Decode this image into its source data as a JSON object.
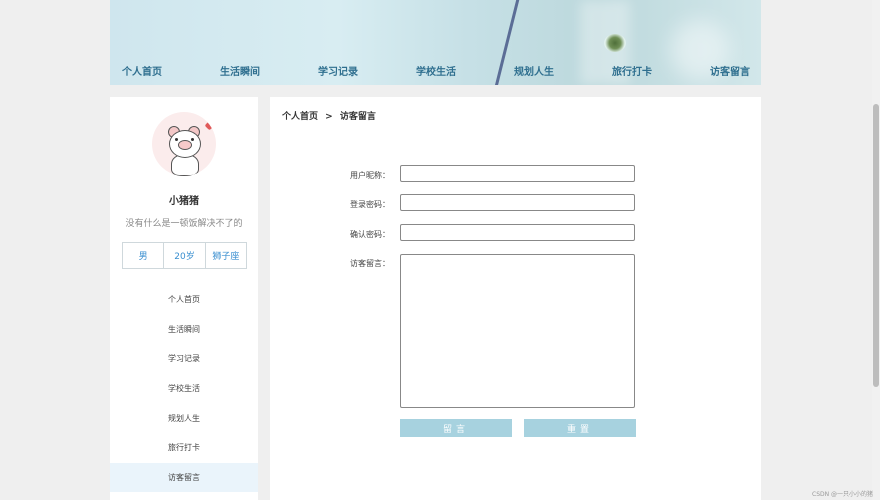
{
  "nav": {
    "items": [
      {
        "label": "个人首页"
      },
      {
        "label": "生活瞬间"
      },
      {
        "label": "学习记录"
      },
      {
        "label": "学校生活"
      },
      {
        "label": "规划人生"
      },
      {
        "label": "旅行打卡"
      },
      {
        "label": "访客留言"
      }
    ]
  },
  "profile": {
    "name": "小猪猪",
    "motto": "没有什么是一顿饭解决不了的",
    "gender": "男",
    "age": "20岁",
    "zodiac": "狮子座"
  },
  "sidebar": {
    "items": [
      {
        "label": "个人首页"
      },
      {
        "label": "生活瞬间"
      },
      {
        "label": "学习记录"
      },
      {
        "label": "学校生活"
      },
      {
        "label": "规划人生"
      },
      {
        "label": "旅行打卡"
      },
      {
        "label": "访客留言"
      }
    ],
    "active": "访客留言"
  },
  "breadcrumb": {
    "home": "个人首页",
    "separator": ">",
    "current": "访客留言"
  },
  "form": {
    "nickname_label": "用户昵称：",
    "nickname_value": "",
    "password_label": "登录密码：",
    "password_value": "",
    "confirm_label": "确认密码：",
    "confirm_value": "",
    "message_label": "访客留言：",
    "message_value": "",
    "submit_label": "留言",
    "reset_label": "重置"
  },
  "colors": {
    "accent": "#2f6f8f",
    "button": "#a7d2df",
    "link": "#3a8fd0"
  },
  "watermark": "CSDN @一只小小的猪"
}
